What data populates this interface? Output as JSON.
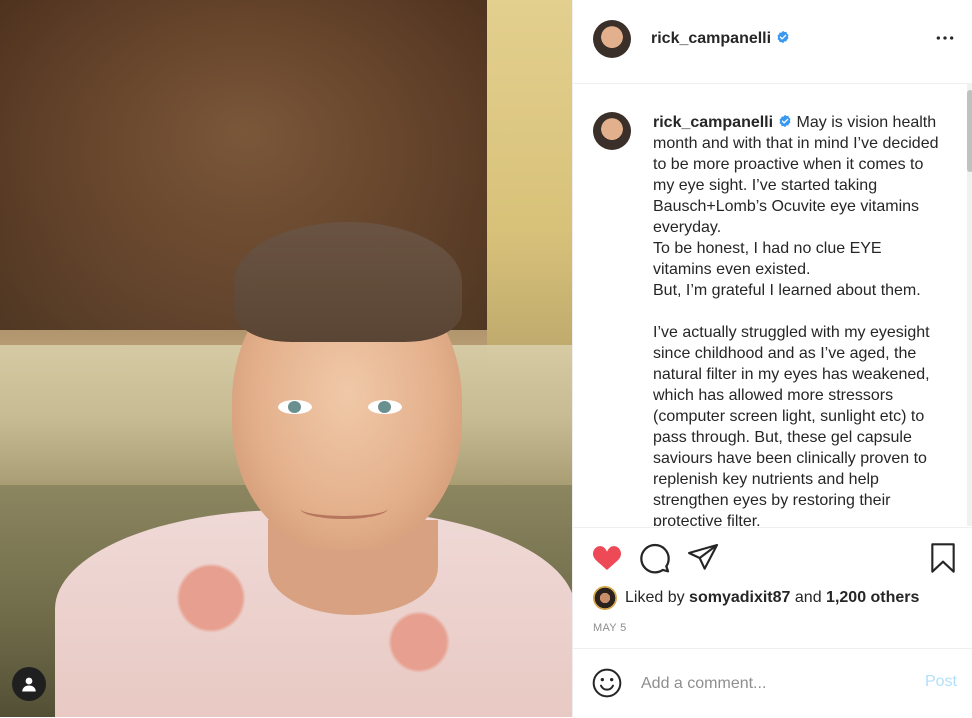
{
  "post": {
    "username": "rick_campanelli",
    "verified": true
  },
  "caption": {
    "lines": [
      "May is vision health month and with that in mind I’ve decided to be more proactive when it comes to my eye sight. I’ve started taking Bausch+Lomb’s Ocuvite eye vitamins everyday.",
      "To be honest, I had no clue EYE vitamins even existed.",
      "But, I’m grateful I learned about them.",
      "",
      "I’ve actually struggled with my eyesight since childhood and as I’ve aged, the natural filter in my eyes has weakened, which has allowed more stressors (computer screen light, sunlight etc) to pass through. But, these gel capsule saviours have been clinically proven to replenish key nutrients and help strengthen eyes by restoring their protective filter."
    ]
  },
  "likes": {
    "prefix": "Liked by",
    "liker": "somyadixit87",
    "connector": "and",
    "others": "1,200 others"
  },
  "date": "MAY 5",
  "comment_box": {
    "placeholder": "Add a comment...",
    "post_label": "Post"
  },
  "icons": {
    "like": "heart-filled-icon",
    "comment": "comment-icon",
    "share": "paper-plane-icon",
    "save": "bookmark-icon",
    "more": "more-horizontal-icon",
    "emoji": "emoji-icon",
    "verified": "verified-badge-icon",
    "user": "user-icon"
  },
  "colors": {
    "like": "#ed4956",
    "verified": "#3897f0",
    "post_disabled": "#b2dffc",
    "muted": "#8e8e8e"
  }
}
